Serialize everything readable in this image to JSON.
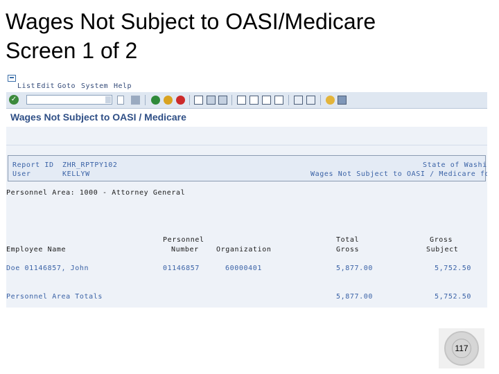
{
  "slide": {
    "title_line1": "Wages Not Subject to OASI/Medicare",
    "title_line2": "Screen 1 of 2",
    "page_number": "117"
  },
  "menu": [
    "List",
    "Edit",
    "Goto",
    "System",
    "Help"
  ],
  "toolbar": {
    "command_field_value": "",
    "icons": [
      "enter-icon",
      "save-icon",
      "back-icon",
      "exit-icon",
      "cancel-icon",
      "print-icon",
      "find-icon",
      "find-next-icon",
      "first-page-icon",
      "previous-page-icon",
      "next-page-icon",
      "last-page-icon",
      "new-session-icon",
      "shortcut-icon",
      "help-icon",
      "layout-icon"
    ]
  },
  "screen_title": "Wages Not Subject to OASI / Medicare",
  "report_header": {
    "report_id_label": "Report ID",
    "report_id_value": "ZHR_RPTPY102",
    "user_label": "User",
    "user_value": "KELLYW",
    "right_line1": "State of Washi",
    "right_line2": "Wages Not Subject to OASI / Medicare for"
  },
  "personnel_area": "Personnel Area: 1000 - Attorney General",
  "table": {
    "headers": {
      "employee_name": "Employee Name",
      "personnel_1": "Personnel",
      "personnel_2": "Number",
      "organization": "Organization",
      "total_1": "Total",
      "total_2": "Gross",
      "gross_1": "Gross",
      "gross_2": "Subject"
    },
    "rows": [
      {
        "employee_name": "Doe 01146857, John",
        "personnel_number": "01146857",
        "organization": "60000401",
        "total_gross": "5,877.00",
        "gross_subject": "5,752.50"
      }
    ],
    "totals": {
      "label": "Personnel Area Totals",
      "total_gross": "5,877.00",
      "gross_subject": "5,752.50"
    }
  },
  "colors": {
    "sap_background": "#eef2f8",
    "title_blue": "#2f4f86",
    "toolbar": "#dfe7f1"
  }
}
